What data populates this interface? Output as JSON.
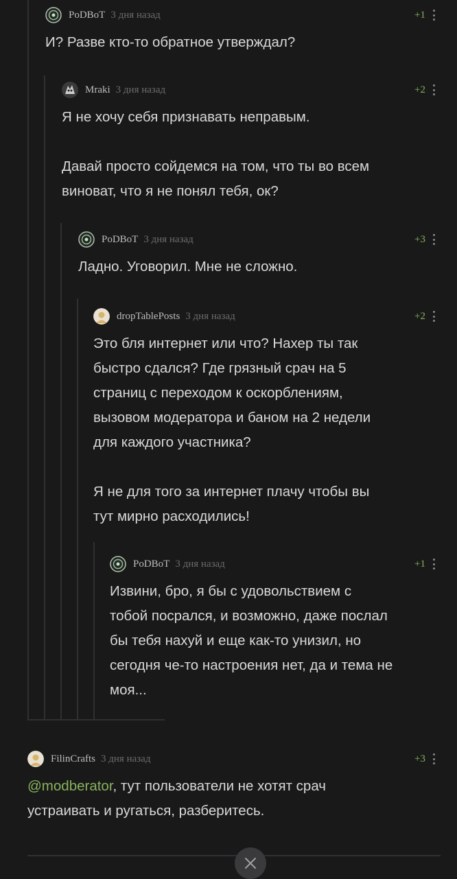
{
  "comments": [
    {
      "author": "PoDBoT",
      "time": "3 дня назад",
      "rating": "+1",
      "paragraphs": [
        "И? Разве кто-то обратное утверждал?"
      ]
    },
    {
      "author": "Mraki",
      "time": "3 дня назад",
      "rating": "+2",
      "paragraphs": [
        "Я не хочу себя признавать неправым.",
        "Давай просто сойдемся на том, что ты во всем\nвиноват, что я не понял тебя, ок?"
      ]
    },
    {
      "author": "PoDBoT",
      "time": "3 дня назад",
      "rating": "+3",
      "paragraphs": [
        "Ладно. Уговорил. Мне не сложно."
      ]
    },
    {
      "author": "dropTablePosts",
      "time": "3 дня назад",
      "rating": "+2",
      "paragraphs": [
        "Это бля интернет или что? Нахер ты так\nбыстро сдался? Где грязный срач на 5\nстраниц с переходом к оскорблениям,\nвызовом модератора и баном на 2 недели\nдля каждого участника?",
        "Я не для того за интернет плачу чтобы вы\nтут мирно расходились!"
      ]
    },
    {
      "author": "PoDBoT",
      "time": "3 дня назад",
      "rating": "+1",
      "paragraphs": [
        "Извини, бро, я бы с удовольствием с\nтобой посрался, и возможно, даже послал\nбы тебя нахуй и еще как-то унизил, но\nсегодня че-то настроения нет, да и тема не\nмоя..."
      ]
    },
    {
      "author": "FilinCrafts",
      "time": "3 дня назад",
      "rating": "+3",
      "mention": "@modberator",
      "paragraphs": [
        ", тут пользователи не хотят срач\nустраивать и ругаться, разберитесь."
      ]
    }
  ],
  "icons": {
    "avatar_podbot": "robot-avatar-icon",
    "avatar_mraki": "character-avatar-icon",
    "avatar_default": "default-avatar-icon",
    "more": "more-vertical-icon",
    "close": "close-icon"
  },
  "colors": {
    "background": "#19191a",
    "text": "#d9d9d9",
    "author": "#bdbdbd",
    "time": "#6c6c6c",
    "rating_positive": "#88b35c",
    "thread_line": "#303032"
  }
}
